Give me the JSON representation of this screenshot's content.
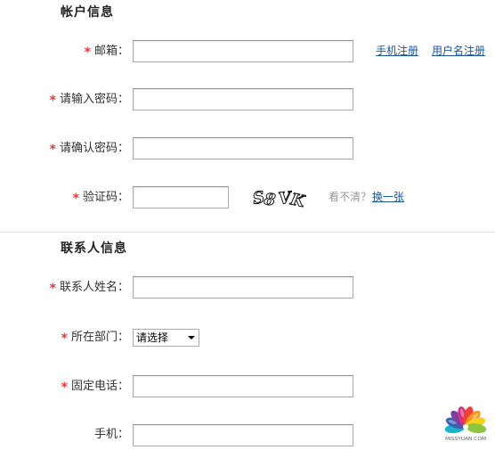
{
  "required_mark": "*",
  "account": {
    "title": "帐户信息",
    "email": {
      "label": "邮箱：",
      "value": ""
    },
    "register_links": {
      "phone": "手机注册",
      "username": "用户名注册"
    },
    "password": {
      "label": "请输入密码：",
      "value": ""
    },
    "confirm_password": {
      "label": "请确认密码：",
      "value": ""
    },
    "captcha": {
      "label": "验证码：",
      "value": "",
      "image_text": "S8VK",
      "hint": "看不清？",
      "refresh": "换一张"
    }
  },
  "contact": {
    "title": "联系人信息",
    "name": {
      "label": "联系人姓名：",
      "value": ""
    },
    "department": {
      "label": "所在部门：",
      "selected": "请选择",
      "icon": "dropdown-arrow-icon"
    },
    "landline": {
      "label": "固定电话：",
      "value": ""
    },
    "mobile": {
      "label": "手机：",
      "value": ""
    }
  },
  "colors": {
    "required_mark": "#e4393c",
    "label": "#333333",
    "title": "#222222",
    "link": "#1a56a0",
    "hint": "#999999",
    "input_border": "#a9adb3",
    "divider": "#e3e3e3"
  },
  "watermark": {
    "text": "MISSYUAN.COM",
    "petal_colors": [
      "#19b3c9",
      "#3a5fb5",
      "#7b3fa3",
      "#d8307e",
      "#ef4136",
      "#f7941d",
      "#f6d21e",
      "#8cc63f"
    ]
  }
}
